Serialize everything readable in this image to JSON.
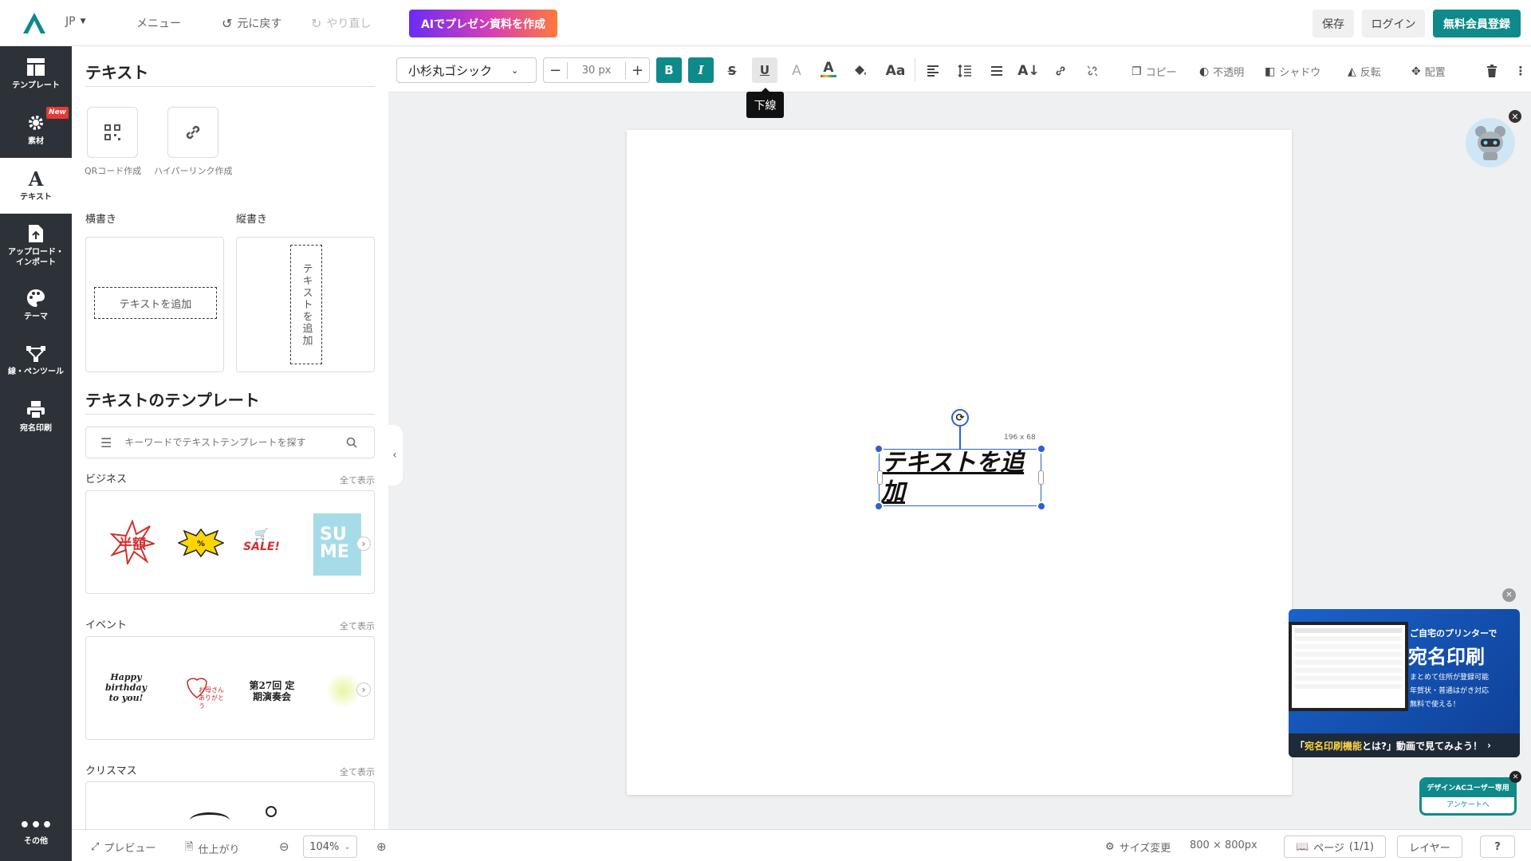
{
  "topbar": {
    "lang": "JP",
    "menu": "メニュー",
    "undo": "元に戻す",
    "redo": "やり直し",
    "ai_button": "AIでプレゼン資料を作成",
    "save": "保存",
    "login": "ログイン",
    "signup": "無料会員登録"
  },
  "sidebar": {
    "items": [
      {
        "label": "テンプレート"
      },
      {
        "label": "素材",
        "badge": "New"
      },
      {
        "label": "テキスト"
      },
      {
        "label": "アップロード・インポート"
      },
      {
        "label": "テーマ"
      },
      {
        "label": "線・ペンツール"
      },
      {
        "label": "宛名印刷"
      }
    ],
    "other": "その他"
  },
  "panel": {
    "title": "テキスト",
    "qr_label": "QRコード作成",
    "link_label": "ハイパーリンク作成",
    "horizontal_label": "横書き",
    "vertical_label": "縦書き",
    "add_text": "テキストを追加",
    "templates_title": "テキストのテンプレート",
    "search_placeholder": "キーワードでテキストテンプレートを探す",
    "show_all": "全て表示",
    "sections": [
      "ビジネス",
      "イベント",
      "クリスマス"
    ],
    "business_items": [
      "半額",
      "SALE!"
    ],
    "event_items": [
      "Happy birthday to you!",
      "お母さん ありがとう",
      "第27回 定期演奏会"
    ]
  },
  "toolbar": {
    "font": "小杉丸ゴシック",
    "font_size": "30 px",
    "tooltip": "下線",
    "copy": "コピー",
    "opacity": "不透明",
    "shadow": "シャドウ",
    "flip": "反転",
    "arrange": "配置"
  },
  "canvas": {
    "text": "テキストを追加",
    "size_label": "196 x 68"
  },
  "ad": {
    "line1": "ご自宅のプリンターで",
    "line2": "宛名印刷",
    "bullets": [
      "まとめて住所が登録可能",
      "年賀状・普通はがき対応",
      "無料で使える！"
    ],
    "bottom_highlight": "宛名印刷機能",
    "bottom_rest": "とは?」動画で見てみよう！",
    "bottom_prefix": "「"
  },
  "survey": {
    "line1": "デザインACユーザー専用",
    "line2": "アンケートへ"
  },
  "bottombar": {
    "preview": "プレビュー",
    "finish": "仕上がり",
    "zoom": "104%",
    "resize": "サイズ変更",
    "canvas_size": "800 × 800px",
    "page": "ページ",
    "page_count": "(1/1)",
    "layer": "レイヤー"
  },
  "colors": {
    "accent": "#0f8a8a",
    "sidebar": "#2d3238",
    "handle": "#2b5fd9"
  }
}
